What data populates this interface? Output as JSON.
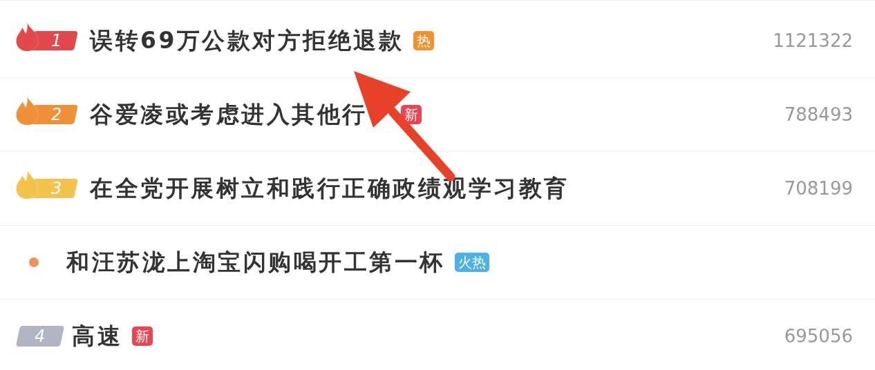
{
  "items": [
    {
      "kind": "top",
      "rank": "1",
      "color": "#e2494c",
      "title": "误转69万公款对方拒绝退款",
      "tag": {
        "text": "热",
        "color": "#f0932d"
      },
      "count": "1121322"
    },
    {
      "kind": "top",
      "rank": "2",
      "color": "#f0913a",
      "title": "谷爱凌或考虑进入其他行",
      "tag": {
        "text": "新",
        "color": "#e84652"
      },
      "count": "788493"
    },
    {
      "kind": "top",
      "rank": "3",
      "color": "#f3c34c",
      "title": "在全党开展树立和践行正确政绩观学习教育",
      "count": "708199"
    },
    {
      "kind": "promo",
      "color": "#f0905a",
      "title": "和汪苏泷上淘宝闪购喝开工第一杯",
      "tag": {
        "text": "火热",
        "color": "#4db1e6"
      }
    },
    {
      "kind": "plain",
      "rank": "4",
      "color": "#b0b5c4",
      "title": "高速",
      "tag": {
        "text": "新",
        "color": "#e84652"
      },
      "count": "695056"
    }
  ]
}
